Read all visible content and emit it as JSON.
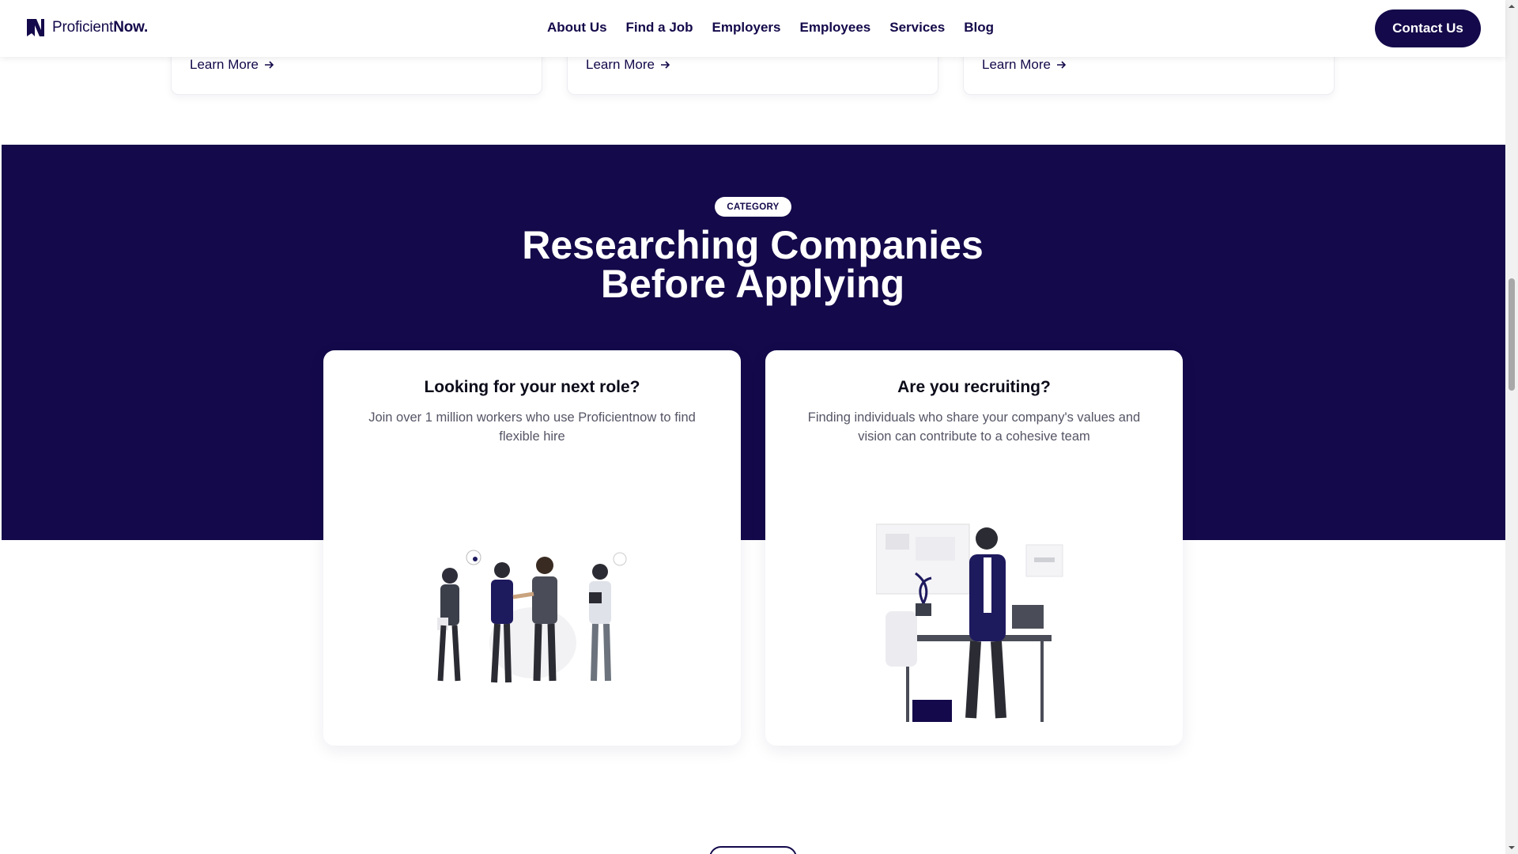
{
  "header": {
    "logo_prefix": "Proficient",
    "logo_suffix": "Now.",
    "nav": [
      "About Us",
      "Find a Job",
      "Employers",
      "Employees",
      "Services",
      "Blog"
    ],
    "contact_label": "Contact Us"
  },
  "top_cards": [
    {
      "link": "Learn More"
    },
    {
      "link": "Learn More"
    },
    {
      "link": "Learn More"
    }
  ],
  "section": {
    "category": "CATEGORY",
    "title_line1": "Researching Companies",
    "title_line2": "Before Applying"
  },
  "cards": [
    {
      "title": "Looking for your next role?",
      "description": "Join over 1 million workers who use Proficientnow to find flexible hire"
    },
    {
      "title": "Are you recruiting?",
      "description": "Finding individuals who share your company's values and vision can contribute to a cohesive team"
    }
  ],
  "colors": {
    "brand": "#14094a",
    "background": "#ffffff"
  },
  "icons": [
    "logo-mark-icon",
    "arrow-right-icon",
    "team-illustration",
    "recruiter-illustration"
  ]
}
